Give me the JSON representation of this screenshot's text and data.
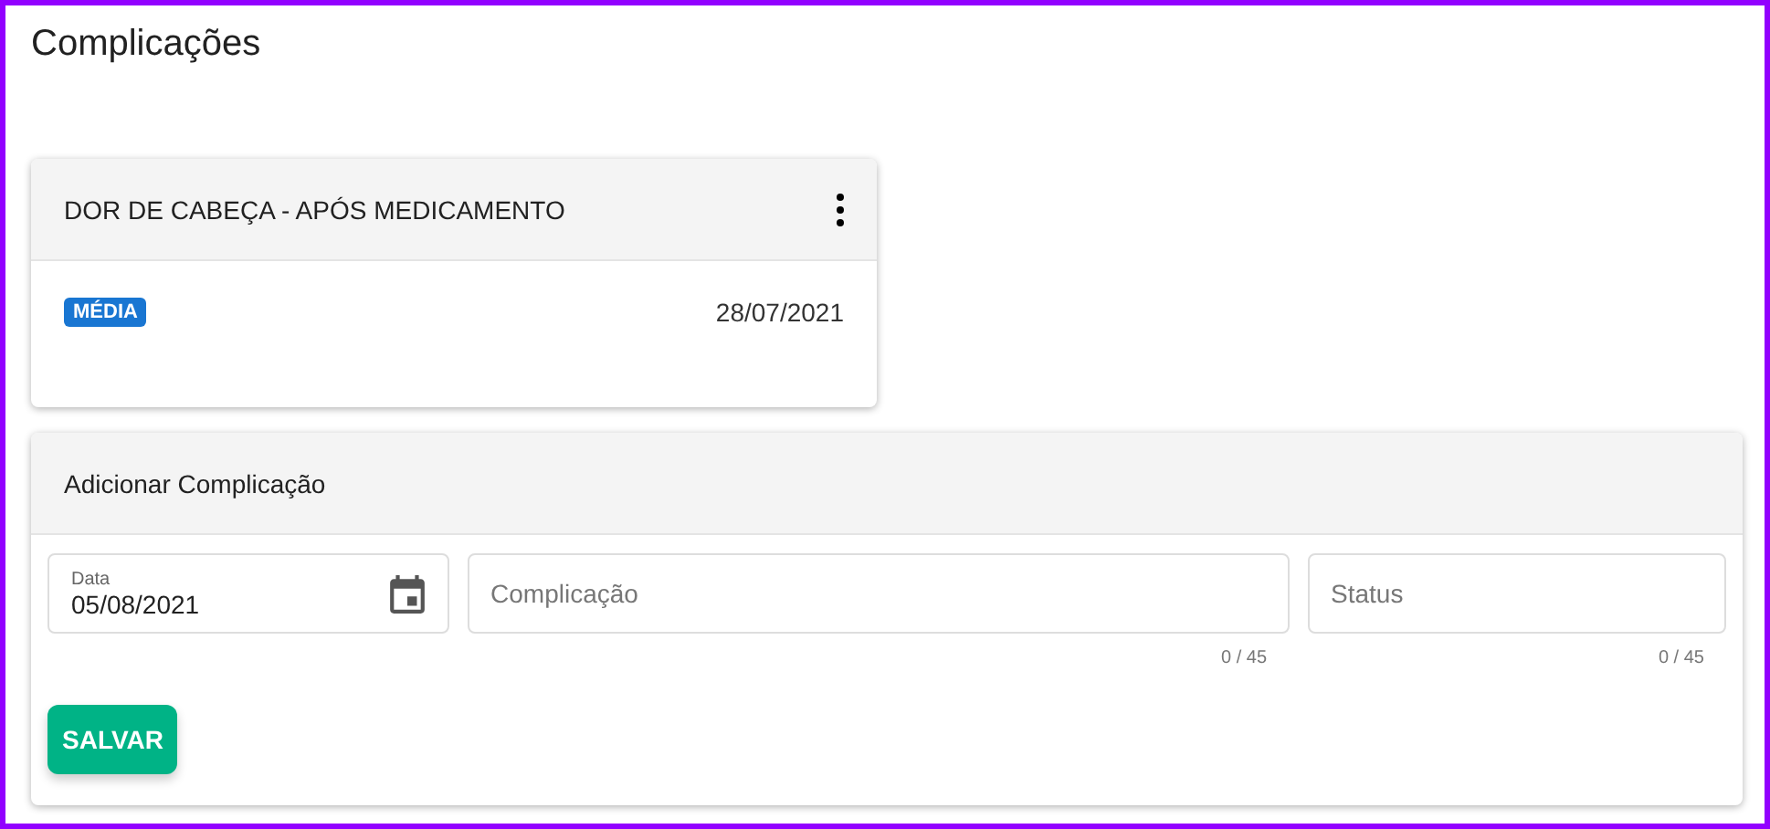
{
  "page_title": "Complicações",
  "complications": [
    {
      "title": "DOR DE CABEÇA - APÓS MEDICAMENTO",
      "severity": "MÉDIA",
      "color": "#1976d2",
      "date": "28/07/2021"
    }
  ],
  "form": {
    "title": "Adicionar Complicação",
    "fields": [
      {
        "kind": "date",
        "label": "Data",
        "value": "05/08/2021"
      },
      {
        "kind": "text",
        "placeholder": "Complicação",
        "counter": "0 / 45"
      },
      {
        "kind": "text",
        "placeholder": "Status",
        "counter": "0 / 45"
      }
    ],
    "save_button": "SALVAR"
  }
}
